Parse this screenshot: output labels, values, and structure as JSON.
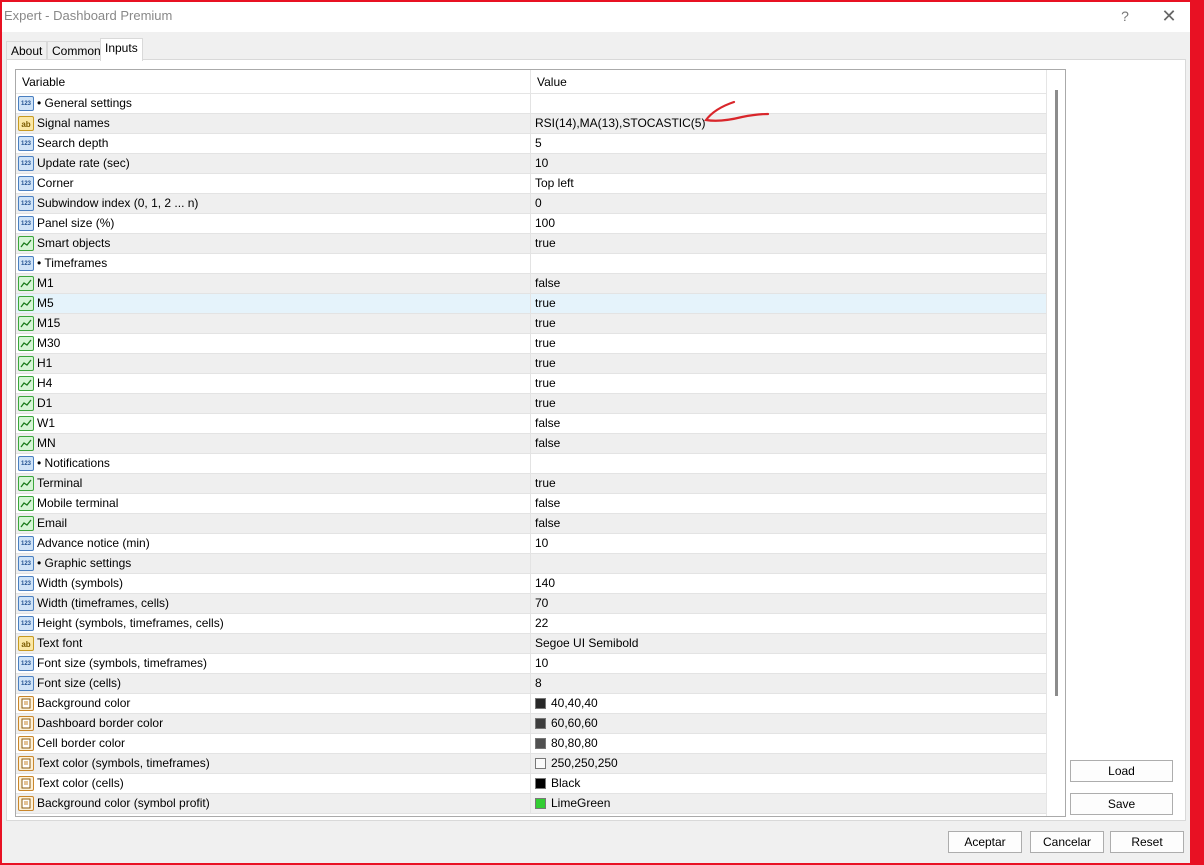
{
  "window": {
    "title": "Expert - Dashboard Premium",
    "help_glyph": "?",
    "close_glyph": "✕"
  },
  "tabs": [
    {
      "label": "About",
      "active": false
    },
    {
      "label": "Common",
      "active": false
    },
    {
      "label": "Inputs",
      "active": true
    }
  ],
  "grid": {
    "columns": [
      "Variable",
      "Value"
    ],
    "rows": [
      {
        "type": "num",
        "variable": "•      General settings",
        "value": "",
        "group": true
      },
      {
        "type": "str",
        "variable": "Signal names",
        "value": "RSI(14),MA(13),STOCASTIC(5)"
      },
      {
        "type": "num",
        "variable": "Search depth",
        "value": "5"
      },
      {
        "type": "num",
        "variable": "Update rate (sec)",
        "value": "10"
      },
      {
        "type": "num",
        "variable": "Corner",
        "value": "Top left"
      },
      {
        "type": "num",
        "variable": "Subwindow index (0, 1, 2 ... n)",
        "value": "0"
      },
      {
        "type": "num",
        "variable": "Panel size (%)",
        "value": "100"
      },
      {
        "type": "bool",
        "variable": "Smart objects",
        "value": "true"
      },
      {
        "type": "num",
        "variable": "•      Timeframes",
        "value": "",
        "group": true
      },
      {
        "type": "bool",
        "variable": "M1",
        "value": "false"
      },
      {
        "type": "bool",
        "variable": "M5",
        "value": "true",
        "selected": true
      },
      {
        "type": "bool",
        "variable": "M15",
        "value": "true"
      },
      {
        "type": "bool",
        "variable": "M30",
        "value": "true"
      },
      {
        "type": "bool",
        "variable": "H1",
        "value": "true"
      },
      {
        "type": "bool",
        "variable": "H4",
        "value": "true"
      },
      {
        "type": "bool",
        "variable": "D1",
        "value": "true"
      },
      {
        "type": "bool",
        "variable": "W1",
        "value": "false"
      },
      {
        "type": "bool",
        "variable": "MN",
        "value": "false"
      },
      {
        "type": "num",
        "variable": "•      Notifications",
        "value": "",
        "group": true
      },
      {
        "type": "bool",
        "variable": "Terminal",
        "value": "true"
      },
      {
        "type": "bool",
        "variable": "Mobile terminal",
        "value": "false"
      },
      {
        "type": "bool",
        "variable": "Email",
        "value": "false"
      },
      {
        "type": "num",
        "variable": "Advance notice (min)",
        "value": "10"
      },
      {
        "type": "num",
        "variable": "•      Graphic settings",
        "value": "",
        "group": true
      },
      {
        "type": "num",
        "variable": "Width (symbols)",
        "value": "140"
      },
      {
        "type": "num",
        "variable": "Width (timeframes, cells)",
        "value": "70"
      },
      {
        "type": "num",
        "variable": "Height (symbols, timeframes, cells)",
        "value": "22"
      },
      {
        "type": "str",
        "variable": "Text font",
        "value": "Segoe UI Semibold"
      },
      {
        "type": "num",
        "variable": "Font size (symbols, timeframes)",
        "value": "10"
      },
      {
        "type": "num",
        "variable": "Font size (cells)",
        "value": "8"
      },
      {
        "type": "color",
        "variable": "Background color",
        "value": "40,40,40",
        "swatch": "#282828"
      },
      {
        "type": "color",
        "variable": "Dashboard border color",
        "value": "60,60,60",
        "swatch": "#3c3c3c"
      },
      {
        "type": "color",
        "variable": "Cell border color",
        "value": "80,80,80",
        "swatch": "#505050"
      },
      {
        "type": "color",
        "variable": "Text color (symbols, timeframes)",
        "value": "250,250,250",
        "swatch": "#fafafa"
      },
      {
        "type": "color",
        "variable": "Text color (cells)",
        "value": "Black",
        "swatch": "#000000"
      },
      {
        "type": "color",
        "variable": "Background color (symbol profit)",
        "value": "LimeGreen",
        "swatch": "#32cd32"
      }
    ]
  },
  "side_buttons": {
    "load": "Load",
    "save": "Save"
  },
  "footer_buttons": {
    "ok": "Aceptar",
    "cancel": "Cancelar",
    "reset": "Reset"
  },
  "icon_labels": {
    "num": "123",
    "str": "ab"
  },
  "colors": {
    "annotation": "#d9262b",
    "selection": "#e5f3fb",
    "window_border": "#e81123"
  }
}
